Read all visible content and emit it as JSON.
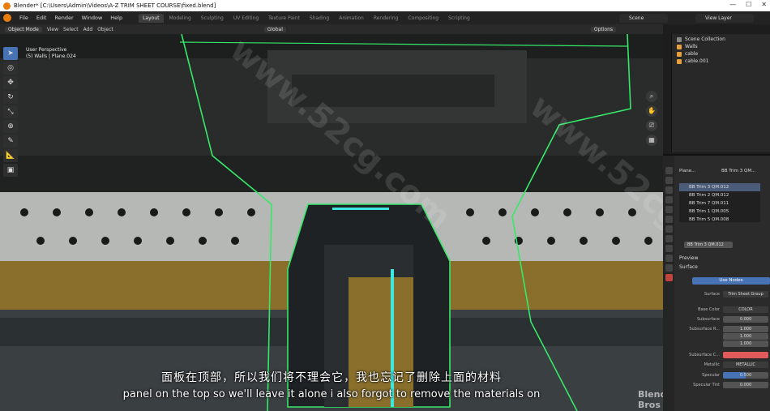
{
  "window": {
    "title": "Blender* [C:\\Users\\Admin\\Videos\\A-Z TRIM SHEET COURSE\\fixed.blend]"
  },
  "menu": {
    "items": [
      "File",
      "Edit",
      "Render",
      "Window",
      "Help"
    ]
  },
  "workspaces": {
    "tabs": [
      "Layout",
      "Modeling",
      "Sculpting",
      "UV Editing",
      "Texture Paint",
      "Shading",
      "Animation",
      "Rendering",
      "Compositing",
      "Scripting"
    ],
    "active": "Layout"
  },
  "scene": {
    "label": "Scene",
    "view_layer": "View Layer"
  },
  "viewport": {
    "mode": "Object Mode",
    "menus": [
      "View",
      "Select",
      "Add",
      "Object"
    ],
    "orientation": "Global",
    "options": "Options",
    "info_line1": "User Perspective",
    "info_line2": "(5) Walls | Plane.024"
  },
  "outliner": {
    "title": "Scene Collection",
    "items": [
      "Walls",
      "cable",
      "cable.001"
    ]
  },
  "properties": {
    "object": "Plane...",
    "material_slot": "BB Trim 3 QM...",
    "materials": [
      "BB Trim 3 QM.012",
      "BB Trim 2 QM.012",
      "BB Trim 7 QM.011",
      "BB Trim 1 QM.005",
      "BB Trim 5 QM.008"
    ],
    "active_material": "BB Trim 3 QM.012",
    "preview": "Preview",
    "surface": "Surface",
    "use_nodes": "Use Nodes",
    "surface_label": "Surface",
    "surface_value": "Trim Sheet Group",
    "base_color_label": "Base Color",
    "base_color_value": "COLOR",
    "subsurface_label": "Subsurface",
    "subsurface_value": "0.000",
    "subsurface_r_label": "Subsurface R...",
    "subsurface_r_values": [
      "1.000",
      "1.000",
      "1.000"
    ],
    "subsurface_c_label": "Subsurface C...",
    "metallic_label": "Metallic",
    "metallic_value": "METALLIC",
    "specular_label": "Specular",
    "specular_value": "0.500",
    "specular_tint_label": "Specular Tint",
    "specular_tint_value": "0.000"
  },
  "subtitles": {
    "zh": "面板在顶部，所以我们将不理会它，我也忘记了删除上面的材料",
    "en": "panel on the top so we'll leave it alone i also forgot to remove the materials on"
  },
  "watermark": {
    "text": "www.52cg.com",
    "logo": "Blender Bros"
  },
  "colors": {
    "accent": "#4772b3",
    "outline": "#36e86a",
    "neon": "#3ee6e0"
  }
}
